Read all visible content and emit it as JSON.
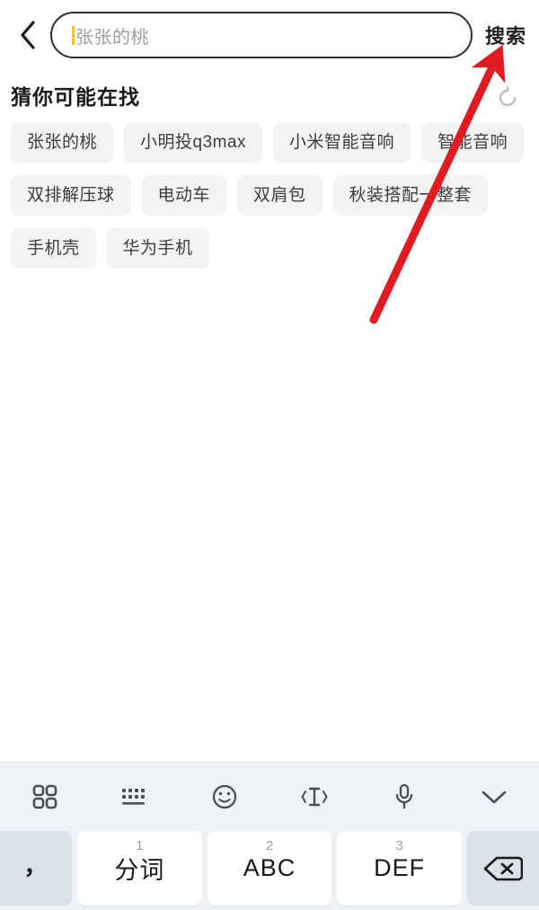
{
  "header": {
    "back_icon": "chevron-left-icon",
    "search_input": {
      "value": "",
      "placeholder": "张张的桃",
      "caret_color": "#f4c430"
    },
    "search_button_label": "搜索"
  },
  "suggestions": {
    "title": "猜你可能在找",
    "refresh_icon": "refresh-icon",
    "chips": [
      "张张的桃",
      "小明投q3max",
      "小米智能音响",
      "智能音响",
      "双排解压球",
      "电动车",
      "双肩包",
      "秋装搭配一整套",
      "手机壳",
      "华为手机"
    ]
  },
  "annotation": {
    "arrow_color": "#e11b22",
    "points_to": "搜索"
  },
  "keyboard": {
    "toolbar": [
      {
        "icon": "grid-apps-icon",
        "label": ""
      },
      {
        "icon": "keyboard-icon",
        "label": ""
      },
      {
        "icon": "emoji-smiley-icon",
        "label": ""
      },
      {
        "icon": "text-cursor-move-icon",
        "label": ""
      },
      {
        "icon": "microphone-icon",
        "label": ""
      },
      {
        "icon": "chevron-down-icon",
        "label": ""
      }
    ],
    "keys": [
      {
        "name": "comma-key",
        "label": "，",
        "num": "",
        "type": "side"
      },
      {
        "name": "fenci-key",
        "label": "分词",
        "num": "1",
        "type": "main"
      },
      {
        "name": "abc-key",
        "label": "ABC",
        "num": "2",
        "type": "main"
      },
      {
        "name": "def-key",
        "label": "DEF",
        "num": "3",
        "type": "main"
      },
      {
        "name": "backspace-key",
        "label": "",
        "num": "",
        "type": "side"
      }
    ]
  },
  "colors": {
    "chip_bg": "#f3f3f3",
    "keyboard_bg": "#eef2f7",
    "key_white": "#ffffff",
    "key_gray": "#dbe1e9",
    "accent_red": "#e11b22"
  }
}
